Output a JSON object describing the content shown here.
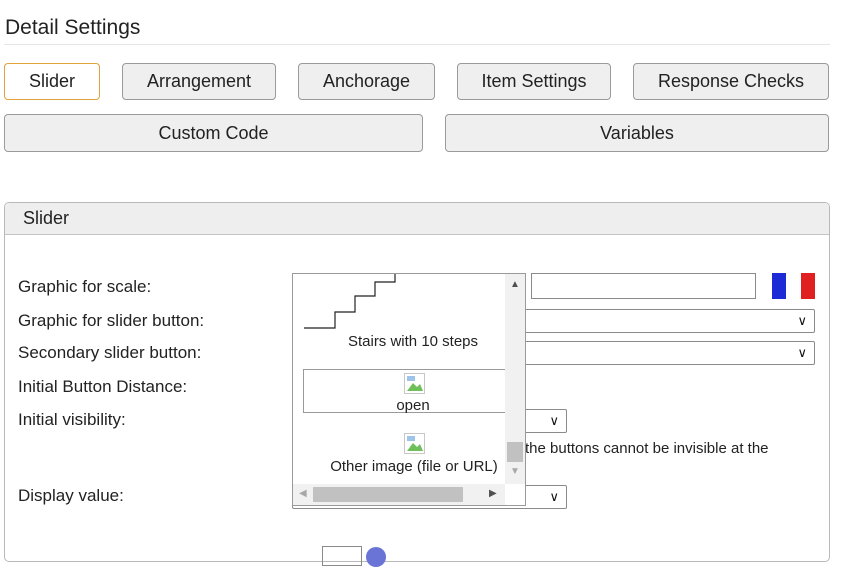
{
  "page": {
    "title": "Detail Settings"
  },
  "tabs": [
    {
      "label": "Slider",
      "active": true
    },
    {
      "label": "Arrangement"
    },
    {
      "label": "Anchorage"
    },
    {
      "label": "Item Settings"
    },
    {
      "label": "Response Checks"
    },
    {
      "label": "Custom Code"
    },
    {
      "label": "Variables"
    }
  ],
  "panel": {
    "title": "Slider",
    "fields": {
      "graphic_for_scale": "Graphic for scale:",
      "graphic_for_slider_button": "Graphic for slider button:",
      "secondary_slider_button": "Secondary slider button:",
      "initial_button_distance": "Initial Button Distance:",
      "initial_visibility": "Initial visibility:",
      "display_value": "Display value:"
    },
    "visibility_note": "the buttons cannot be invisible at the"
  },
  "dropdown": {
    "options": [
      {
        "label": "Stairs with 10 steps",
        "icon": "stairs-icon"
      },
      {
        "label": "open",
        "icon": "broken-image-icon",
        "highlighted": true
      },
      {
        "label": "Other image (file or URL)",
        "icon": "broken-image-icon"
      }
    ]
  },
  "colors": {
    "active_tab_border": "#e2a33c",
    "flag_blue": "#1c2bd6",
    "flag_red": "#e02020",
    "info_icon": "#6a73d6"
  },
  "flag": {
    "icon": "french-flag-icon"
  }
}
